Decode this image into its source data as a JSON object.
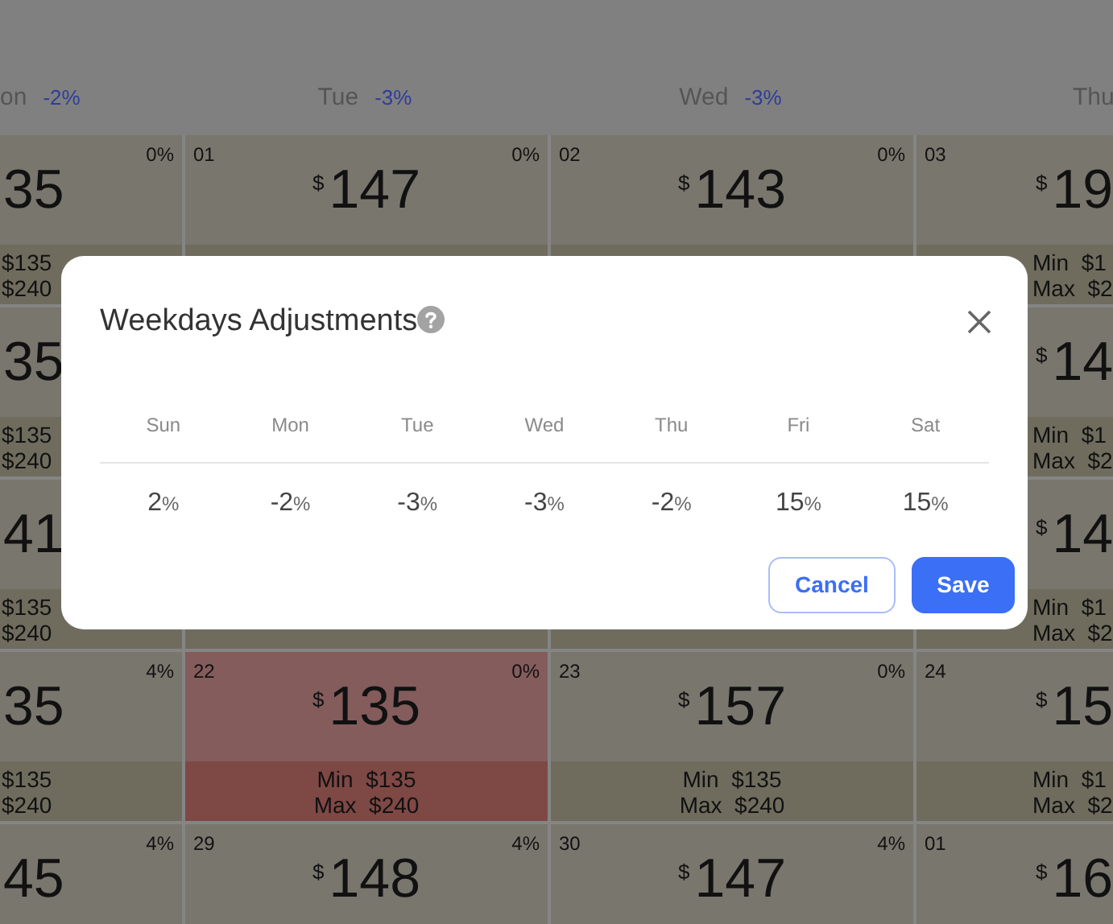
{
  "calendar": {
    "header": [
      {
        "day": "on",
        "pct": "-2%"
      },
      {
        "day": "Tue",
        "pct": "-3%"
      },
      {
        "day": "Wed",
        "pct": "-3%"
      },
      {
        "day": "Thu"
      }
    ],
    "rows": [
      [
        {
          "pct": "0%",
          "price": "35",
          "min": "$135",
          "max": "$240",
          "highlighted": false
        },
        {
          "date": "01",
          "pct": "0%",
          "currency": "$",
          "price": "147",
          "highlighted": false
        },
        {
          "date": "02",
          "pct": "0%",
          "currency": "$",
          "price": "143",
          "highlighted": false
        },
        {
          "date": "03",
          "currency": "$",
          "price": "19",
          "min": "Min  $1",
          "max": "Max  $2",
          "highlighted": false
        }
      ],
      [
        {
          "price": "35",
          "min": "$135",
          "max": "$240",
          "highlighted": false
        },
        {},
        {},
        {
          "currency": "$",
          "price": "14",
          "min": "Min  $1",
          "max": "Max  $2",
          "highlighted": false
        }
      ],
      [
        {
          "price": "41",
          "min": "$135",
          "max": "$240",
          "highlighted": false
        },
        {
          "highlighted": false
        },
        {
          "highlighted": false
        },
        {
          "currency": "$",
          "price": "14",
          "min": "Min  $1",
          "max": "Max  $2",
          "highlighted": false
        }
      ],
      [
        {
          "pct": "4%",
          "price": "35",
          "min": "$135",
          "max": "$240",
          "highlighted": false
        },
        {
          "date": "22",
          "pct": "0%",
          "currency": "$",
          "price": "135",
          "min": "Min  $135",
          "max": "Max  $240",
          "highlighted": true
        },
        {
          "date": "23",
          "pct": "0%",
          "currency": "$",
          "price": "157",
          "min": "Min  $135",
          "max": "Max  $240",
          "highlighted": false
        },
        {
          "date": "24",
          "currency": "$",
          "price": "15",
          "min": "Min  $1",
          "max": "Max  $2",
          "highlighted": false
        }
      ],
      [
        {
          "pct": "4%",
          "price": "45",
          "highlighted": false
        },
        {
          "date": "29",
          "pct": "4%",
          "currency": "$",
          "price": "148",
          "highlighted": false
        },
        {
          "date": "30",
          "pct": "4%",
          "currency": "$",
          "price": "147",
          "highlighted": false
        },
        {
          "date": "01",
          "currency": "$",
          "price": "16",
          "highlighted": false
        }
      ]
    ]
  },
  "dialog": {
    "title": "Weekdays Adjustments",
    "days": [
      {
        "day": "Sun",
        "value": "2",
        "unit": "%"
      },
      {
        "day": "Mon",
        "value": "-2",
        "unit": "%"
      },
      {
        "day": "Tue",
        "value": "-3",
        "unit": "%"
      },
      {
        "day": "Wed",
        "value": "-3",
        "unit": "%"
      },
      {
        "day": "Thu",
        "value": "-2",
        "unit": "%"
      },
      {
        "day": "Fri",
        "value": "15",
        "unit": "%"
      },
      {
        "day": "Sat",
        "value": "15",
        "unit": "%"
      }
    ],
    "buttons": {
      "cancel": "Cancel",
      "save": "Save"
    }
  }
}
